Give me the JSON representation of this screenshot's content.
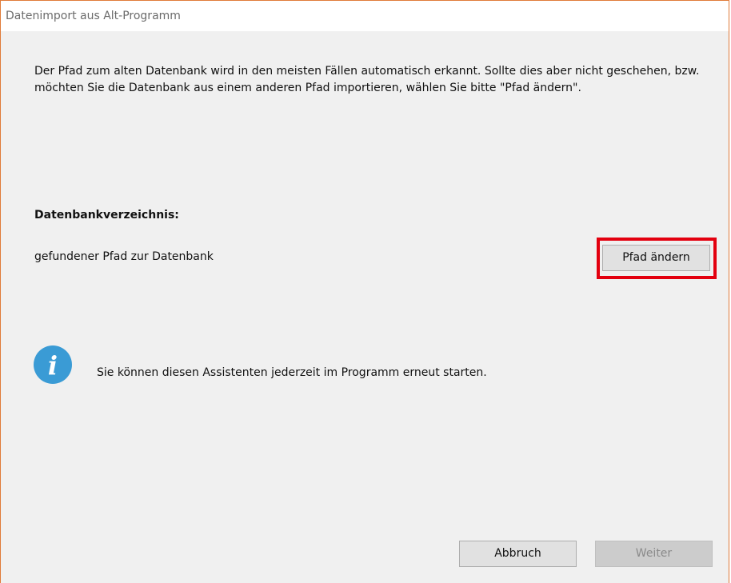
{
  "window": {
    "title": "Datenimport aus Alt-Programm"
  },
  "intro_text": "Der Pfad zum alten Datenbank wird in den meisten Fällen automatisch erkannt. Sollte dies aber nicht geschehen, bzw. möchten Sie die Datenbank aus einem anderen Pfad importieren, wählen Sie bitte \"Pfad ändern\".",
  "database_section": {
    "label": "Datenbankverzeichnis:",
    "path_text": "gefundener Pfad zur Datenbank",
    "change_path_label": "Pfad ändern"
  },
  "info": {
    "icon": "info-icon",
    "text": "Sie können diesen Assistenten jederzeit im Programm erneut starten."
  },
  "footer": {
    "cancel_label": "Abbruch",
    "next_label": "Weiter"
  },
  "colors": {
    "window_border": "#e07b39",
    "highlight": "#e3000f",
    "info_icon": "#3a9bd5"
  }
}
